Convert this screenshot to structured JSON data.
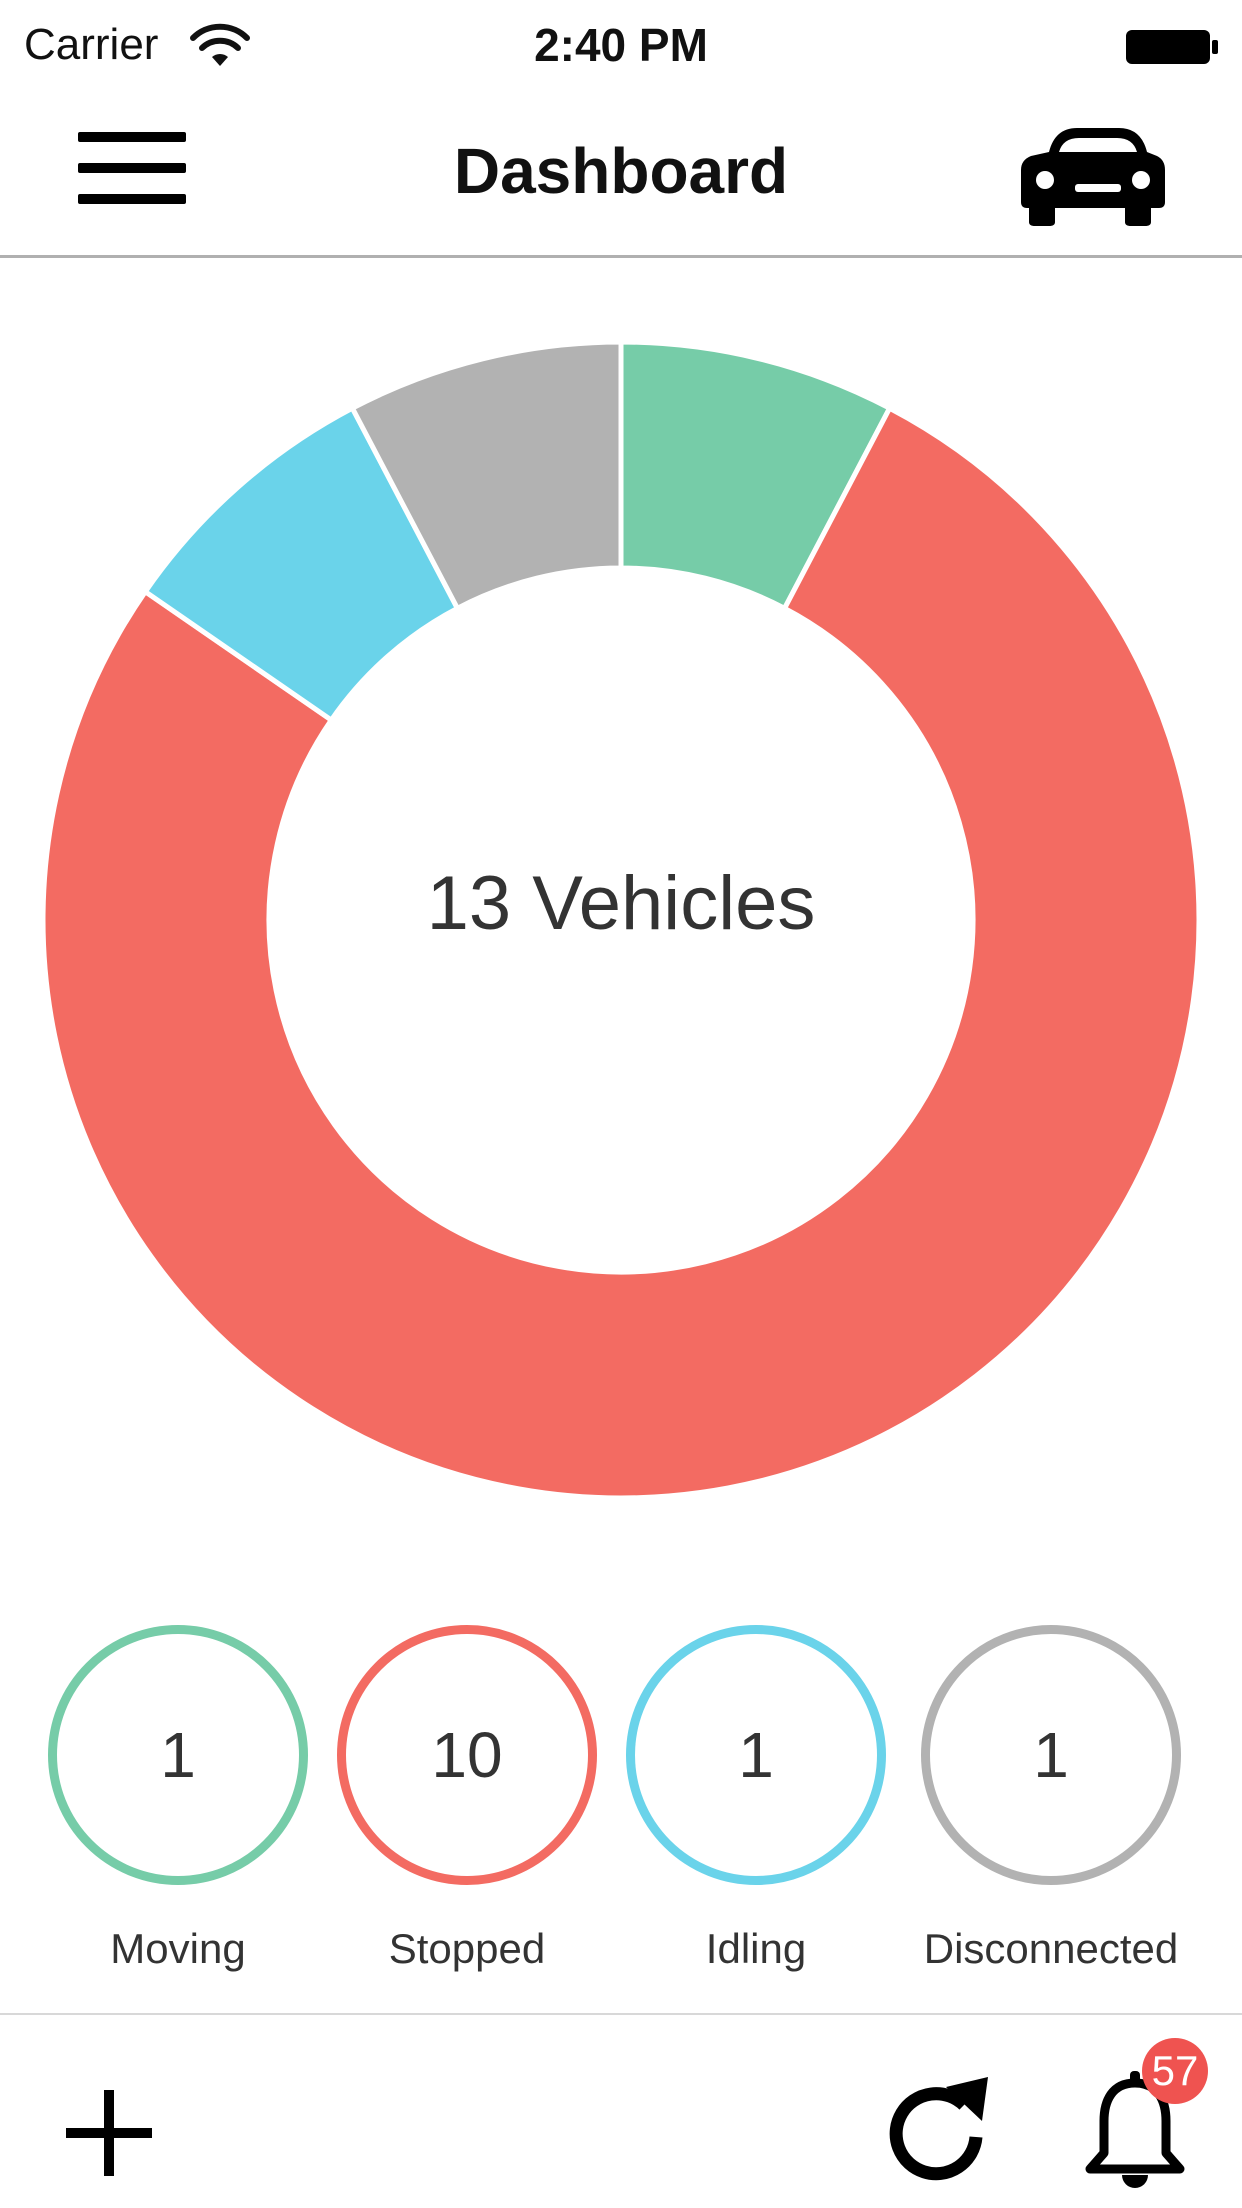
{
  "status_bar": {
    "carrier": "Carrier",
    "time": "2:40 PM"
  },
  "nav": {
    "title": "Dashboard",
    "icons": {
      "menu": "hamburger-menu-icon",
      "right": "car-icon"
    }
  },
  "chart_data": {
    "type": "pie",
    "variant": "donut",
    "categories": [
      "Moving",
      "Stopped",
      "Idling",
      "Disconnected"
    ],
    "values": [
      1,
      10,
      1,
      1
    ],
    "colors": [
      "#76cca8",
      "#f36b62",
      "#6ad3ea",
      "#b2b2b2"
    ],
    "center_label": "13 Vehicles"
  },
  "stats": [
    {
      "label": "Moving",
      "value": "1",
      "color": "#76cca8"
    },
    {
      "label": "Stopped",
      "value": "10",
      "color": "#f36b62"
    },
    {
      "label": "Idling",
      "value": "1",
      "color": "#6ad3ea"
    },
    {
      "label": "Disconnected",
      "value": "1",
      "color": "#b2b2b2"
    }
  ],
  "toolbar": {
    "notifications_count": "57",
    "icons": {
      "add": "plus-icon",
      "refresh": "refresh-icon",
      "notifications": "bell-icon"
    }
  }
}
